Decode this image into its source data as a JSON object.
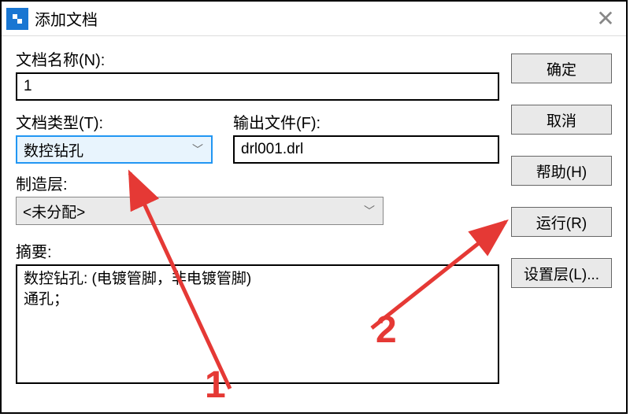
{
  "window": {
    "title": "添加文档"
  },
  "form": {
    "docName": {
      "label": "文档名称(N):",
      "value": "1"
    },
    "docType": {
      "label": "文档类型(T):",
      "value": "数控钻孔"
    },
    "outputFile": {
      "label": "输出文件(F):",
      "value": "drl001.drl"
    },
    "mfgLayer": {
      "label": "制造层:",
      "value": "<未分配>"
    },
    "summary": {
      "label": "摘要:",
      "value": "数控钻孔: (电镀管脚，非电镀管脚)\n通孔；"
    }
  },
  "buttons": {
    "ok": "确定",
    "cancel": "取消",
    "help": "帮助(H)",
    "run": "运行(R)",
    "setLayers": "设置层(L)..."
  },
  "annotations": {
    "one": "1",
    "two": "2"
  }
}
